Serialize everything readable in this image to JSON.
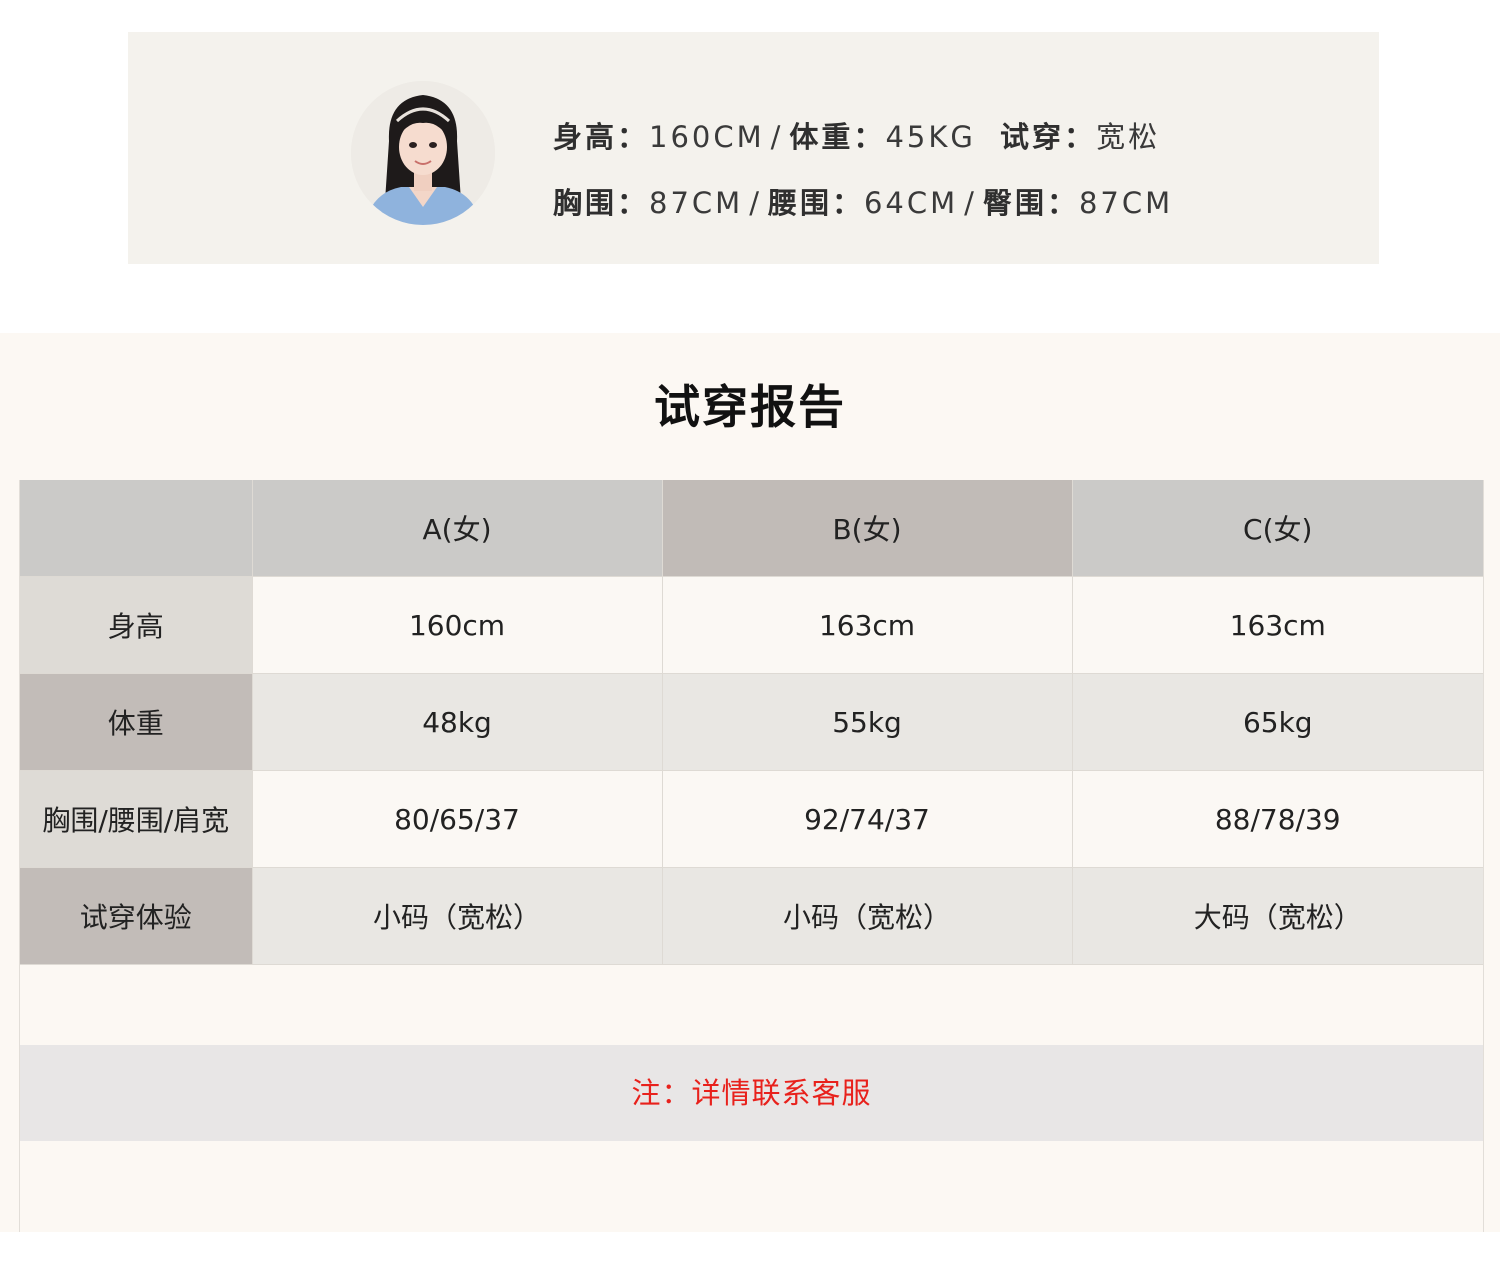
{
  "model": {
    "line1": [
      {
        "label": "身高：",
        "value": "160CM"
      },
      {
        "label": "体重：",
        "value": "45KG"
      },
      {
        "label": "试穿：",
        "value": "宽松"
      }
    ],
    "line2": [
      {
        "label": "胸围：",
        "value": "87CM"
      },
      {
        "label": "腰围：",
        "value": "64CM"
      },
      {
        "label": "臀围：",
        "value": "87CM"
      }
    ],
    "separator": "/"
  },
  "report": {
    "title": "试穿报告",
    "headers": [
      "",
      "A(女)",
      "B(女)",
      "C(女)"
    ],
    "rows": [
      {
        "label": "身高",
        "values": [
          "160cm",
          "163cm",
          "163cm"
        ]
      },
      {
        "label": "体重",
        "values": [
          "48kg",
          "55kg",
          "65kg"
        ]
      },
      {
        "label": "胸围/腰围/肩宽",
        "values": [
          "80/65/37",
          "92/74/37",
          "88/78/39"
        ]
      },
      {
        "label": "试穿体验",
        "values": [
          "小码（宽松）",
          "小码（宽松）",
          "大码（宽松）"
        ]
      }
    ],
    "note": "注：详情联系客服"
  },
  "colors": {
    "note": "#e8211c",
    "card_bg": "#f4f2ed",
    "report_bg": "#fcf8f3"
  }
}
